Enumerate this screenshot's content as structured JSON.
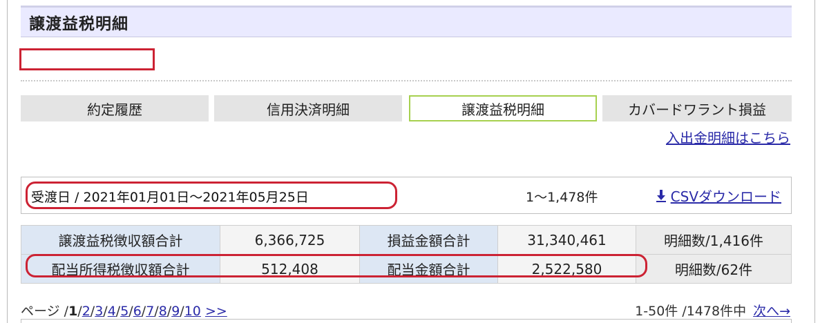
{
  "page_title": "譲渡益税明細",
  "tabs": [
    {
      "label": "約定履歴",
      "active": false
    },
    {
      "label": "信用決済明細",
      "active": false
    },
    {
      "label": "譲渡益税明細",
      "active": true
    },
    {
      "label": "カバードワラント損益",
      "active": false
    }
  ],
  "deposit_link": "入出金明細はこちら",
  "period": {
    "text": "受渡日 / 2021年01月01日～2021年05月25日",
    "count": "1～1,478件",
    "csv_label": "CSVダウンロード"
  },
  "summary": {
    "row1": {
      "label1": "譲渡益税徴収額合計",
      "value1": "6,366,725",
      "label2": "損益金額合計",
      "value2": "31,340,461",
      "count": "明細数/1,416件"
    },
    "row2": {
      "label1": "配当所得税徴収額合計",
      "value1": "512,408",
      "label2": "配当金額合計",
      "value2": "2,522,580",
      "count": "明細数/62件"
    }
  },
  "pager": {
    "prefix": "ページ /",
    "current": "1",
    "pages": [
      "2",
      "3",
      "4",
      "5",
      "6",
      "7",
      "8",
      "9",
      "10"
    ],
    "next_symbol": ">>",
    "range_text": "1-50件 /1478件中",
    "next_label": "次へ→"
  },
  "colors": {
    "accent_link": "#2a2aa8",
    "highlight_red": "#cc2233",
    "active_tab_border": "#a6d04e",
    "title_bg": "#eaeaff"
  }
}
